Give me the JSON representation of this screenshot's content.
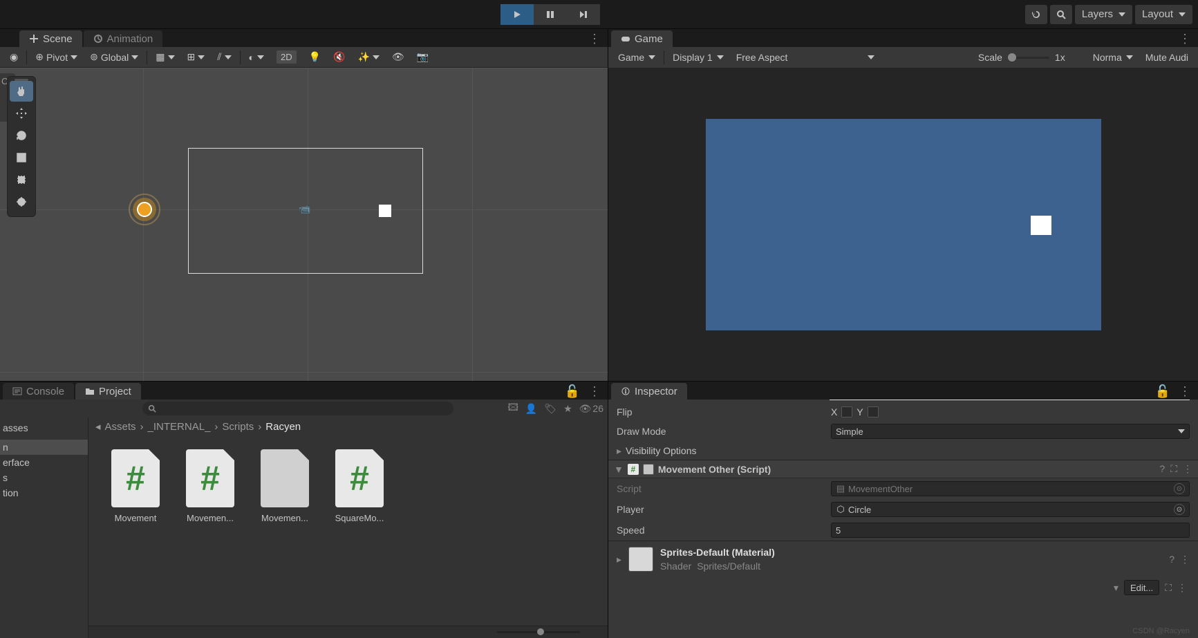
{
  "topbar": {
    "layers": "Layers",
    "layout": "Layout"
  },
  "tabs": {
    "scene": "Scene",
    "animation": "Animation",
    "game": "Game",
    "console": "Console",
    "project": "Project",
    "inspector": "Inspector"
  },
  "scene_toolbar": {
    "pivot": "Pivot",
    "global": "Global",
    "mode2d": "2D"
  },
  "side_cut": "Cai",
  "game_toolbar": {
    "game": "Game",
    "display": "Display 1",
    "aspect": "Free Aspect",
    "scale_label": "Scale",
    "scale_value": "1x",
    "normal": "Norma",
    "mute": "Mute Audi"
  },
  "project": {
    "hidden_count": "26",
    "breadcrumb": [
      "Assets",
      "_INTERNAL_",
      "Scripts",
      "Racyen"
    ],
    "tree": [
      "asses",
      "",
      "n",
      "erface",
      "s",
      "tion"
    ],
    "assets": [
      {
        "name": "Movement",
        "type": "script"
      },
      {
        "name": "Movemen...",
        "type": "script"
      },
      {
        "name": "Movemen...",
        "type": "blank"
      },
      {
        "name": "SquareMo...",
        "type": "script"
      }
    ]
  },
  "inspector": {
    "flip_label": "Flip",
    "flip_x": "X",
    "flip_y": "Y",
    "draw_mode_label": "Draw Mode",
    "draw_mode_value": "Simple",
    "visibility": "Visibility Options",
    "component": {
      "title": "Movement Other (Script)",
      "script_label": "Script",
      "script_value": "MovementOther",
      "player_label": "Player",
      "player_value": "Circle",
      "speed_label": "Speed",
      "speed_value": "5"
    },
    "material": {
      "title": "Sprites-Default (Material)",
      "shader_label": "Shader",
      "shader_value": "Sprites/Default",
      "edit": "Edit..."
    }
  },
  "watermark": "CSDN @Racyen"
}
